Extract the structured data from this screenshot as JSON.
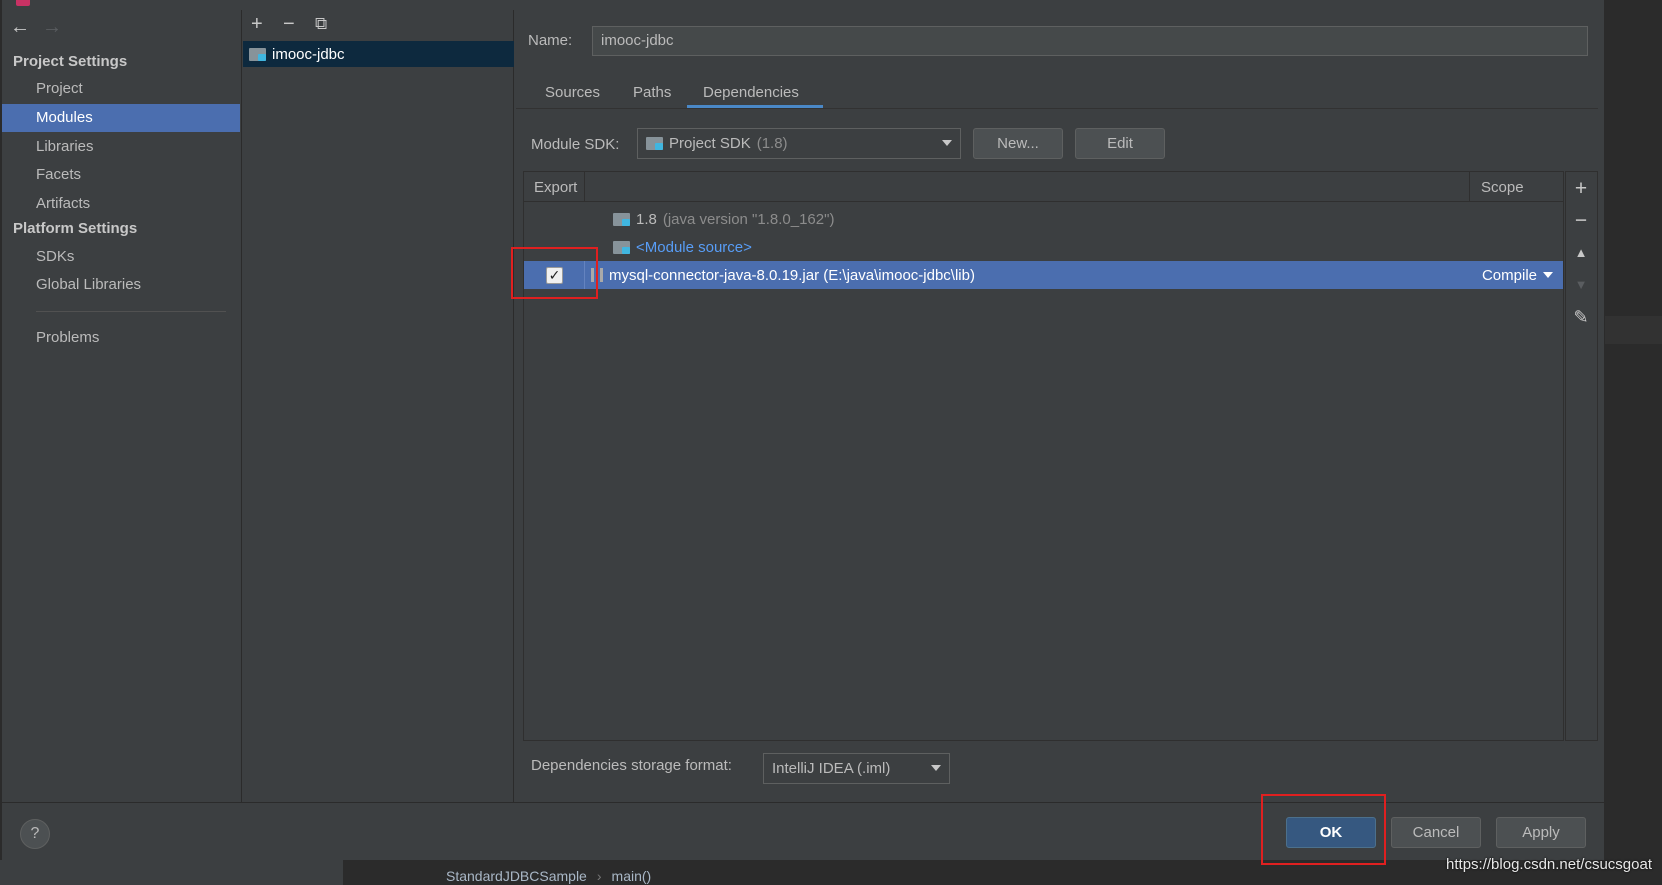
{
  "window": {
    "title": ""
  },
  "nav": {
    "project_settings_header": "Project Settings",
    "project_settings_items": [
      "Project",
      "Modules",
      "Libraries",
      "Facets",
      "Artifacts"
    ],
    "selected_item": "Modules",
    "platform_settings_header": "Platform Settings",
    "platform_settings_items": [
      "SDKs",
      "Global Libraries"
    ],
    "problems": "Problems",
    "back_icon": "←",
    "forward_icon": "→"
  },
  "module_list": {
    "toolbar": {
      "add": "+",
      "remove": "−",
      "copy": "⧉"
    },
    "modules": [
      "imooc-jdbc"
    ]
  },
  "module": {
    "name_label": "Name:",
    "name_value": "imooc-jdbc",
    "tabs": [
      "Sources",
      "Paths",
      "Dependencies"
    ],
    "active_tab": "Dependencies",
    "sdk_label": "Module SDK:",
    "sdk_value": "Project SDK",
    "sdk_version": "(1.8)",
    "new_button": "New...",
    "edit_button": "Edit"
  },
  "dependencies": {
    "columns": {
      "export": "Export",
      "scope": "Scope"
    },
    "rows": [
      {
        "name": "1.8",
        "detail": "(java version \"1.8.0_162\")",
        "scope": "",
        "export": null
      },
      {
        "name": "<Module source>",
        "detail": "",
        "scope": "",
        "export": null
      },
      {
        "name": "mysql-connector-java-8.0.19.jar (E:\\java\\imooc-jdbc\\lib)",
        "detail": "",
        "scope": "Compile",
        "export": true,
        "selected": true
      }
    ],
    "checkmark": "✓"
  },
  "side_toolbar": {
    "add": "+",
    "remove": "−",
    "up": "▲",
    "down": "▼",
    "edit": "✎"
  },
  "storage": {
    "label": "Dependencies storage format:",
    "value": "IntelliJ IDEA (.iml)"
  },
  "footer": {
    "help": "?",
    "ok": "OK",
    "cancel": "Cancel",
    "apply": "Apply"
  },
  "background": {
    "breadcrumb": [
      "StandardJDBCSample",
      "main()"
    ],
    "breadcrumb_sep": "›",
    "watermark": "https://blog.csdn.net/csucsgoat"
  },
  "colors": {
    "selection": "#4b6eaf",
    "accent": "#4a88c7",
    "annotation": "#e02020"
  }
}
